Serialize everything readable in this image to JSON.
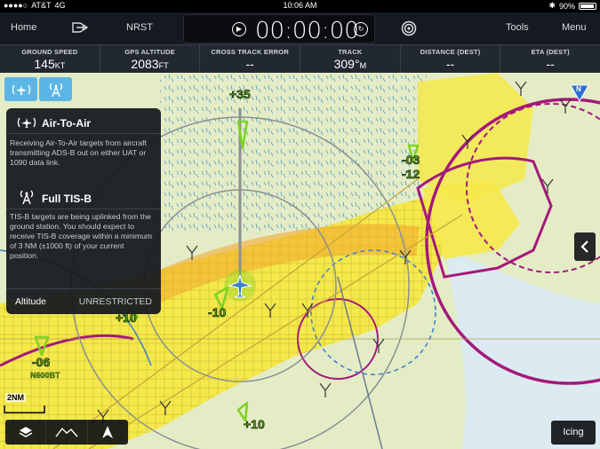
{
  "status_bar": {
    "carrier": "AT&T",
    "network": "4G",
    "time": "10:06 AM",
    "battery": "90%"
  },
  "nav": {
    "home": "Home",
    "nrst": "NRST",
    "tools": "Tools",
    "menu": "Menu"
  },
  "timer": {
    "value": "00:00:00"
  },
  "instruments": [
    {
      "label": "GROUND SPEED",
      "value": "145",
      "unit": "KT"
    },
    {
      "label": "GPS ALTITUDE",
      "value": "2083",
      "unit": "FT"
    },
    {
      "label": "CROSS TRACK ERROR",
      "value": "--",
      "unit": ""
    },
    {
      "label": "TRACK",
      "value": "309°",
      "unit": "M"
    },
    {
      "label": "DISTANCE (DEST)",
      "value": "--",
      "unit": ""
    },
    {
      "label": "ETA (DEST)",
      "value": "--",
      "unit": ""
    }
  ],
  "popover": {
    "air_to_air_title": "Air-To-Air",
    "air_to_air_text": "Receiving Air-To-Air targets from aircraft transmitting ADS-B out on either UAT or 1090 data link.",
    "tisb_title": "Full TIS-B",
    "tisb_text": "TIS-B targets are being uplinked from the ground station. You should expect to receive TIS-B coverage within a minimum of 3 NM (±1000 ft) of your current position.",
    "altitude_label": "Altitude",
    "altitude_value": "UNRESTRICTED"
  },
  "map_labels": {
    "alt_plus35": "+35",
    "alt_minus10": "-10",
    "alt_plus10a": "+10",
    "alt_plus10b": "+10",
    "alt_minus03": "-03",
    "alt_minus12": "-12",
    "alt_minus06": "-06",
    "tail_n600bt": "N600BT",
    "scale": "2NM",
    "north": "N"
  },
  "bottom": {
    "icing": "Icing"
  },
  "colors": {
    "accent_blue": "#5bb6e6",
    "traffic_green": "#7ed321",
    "airspace_magenta": "#a4197a",
    "urban_yellow": "#f5e94a"
  }
}
